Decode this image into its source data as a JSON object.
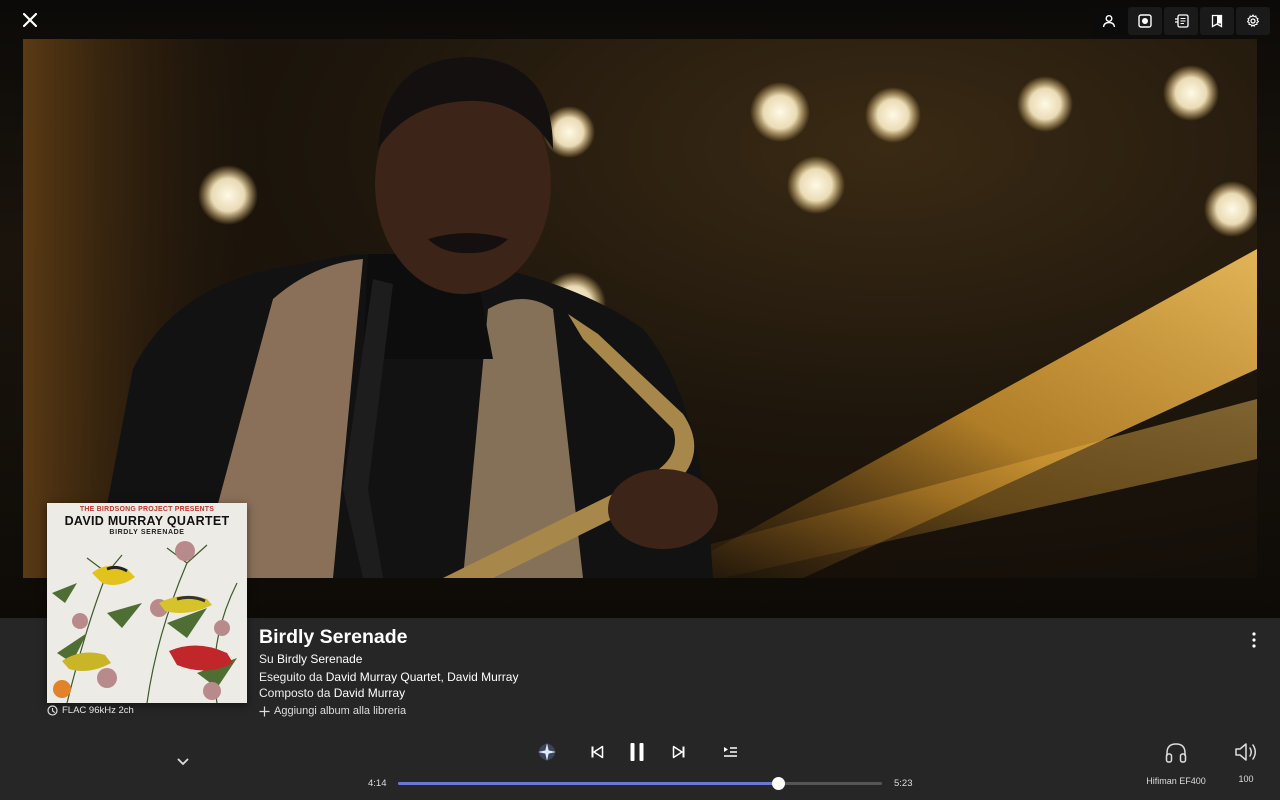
{
  "topbar": {
    "close_icon": "close-icon",
    "tools": [
      {
        "icon": "user-icon",
        "active": true
      },
      {
        "icon": "record-icon",
        "active": false
      },
      {
        "icon": "lyrics-icon",
        "active": false
      },
      {
        "icon": "booklet-icon",
        "active": false
      },
      {
        "icon": "gear-icon",
        "active": false
      }
    ]
  },
  "album_art": {
    "line1": "THE BIRDSONG PROJECT PRESENTS",
    "line2": "DAVID MURRAY QUARTET",
    "line3": "BIRDLY SERENADE"
  },
  "quality": {
    "icon": "quality-icon",
    "label": "FLAC 96kHz 2ch"
  },
  "track": {
    "title": "Birdly Serenade",
    "on_prefix": "Su",
    "album": "Birdly Serenade",
    "performed_prefix": "Eseguito da",
    "performers": "David Murray Quartet, David Murray",
    "composed_prefix": "Composto da",
    "composer": "David Murray",
    "add_to_library": "Aggiungi album alla libreria"
  },
  "player": {
    "elapsed": "4:14",
    "total": "5:23",
    "progress_fraction": 0.786,
    "state": "playing",
    "accent": "#6b77d6"
  },
  "output": {
    "device_icon": "headphones-icon",
    "device_name": "Hifiman EF400",
    "volume_icon": "speaker-icon",
    "volume": "100"
  }
}
